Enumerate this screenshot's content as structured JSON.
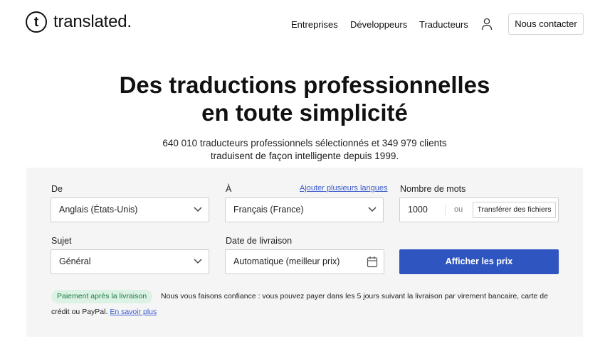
{
  "header": {
    "logo_glyph": "t",
    "logo_text": "translated.",
    "nav": [
      "Entreprises",
      "Développeurs",
      "Traducteurs"
    ],
    "user_icon": "user-icon",
    "contact_label": "Nous contacter"
  },
  "hero": {
    "title_line1": "Des traductions professionnelles",
    "title_line2": "en toute simplicité",
    "subtitle_line1": "640 010 traducteurs professionnels sélectionnés et 349 979 clients",
    "subtitle_line2": "traduisent de façon intelligente depuis 1999."
  },
  "form": {
    "from": {
      "label": "De",
      "value": "Anglais (États-Unis)"
    },
    "to": {
      "label": "À",
      "value": "Français (France)",
      "add_languages_link": "Ajouter plusieurs langues"
    },
    "words": {
      "label": "Nombre de mots",
      "value": "1000",
      "or_text": "ou",
      "upload_label": "Transférer des fichiers"
    },
    "subject": {
      "label": "Sujet",
      "value": "Général"
    },
    "delivery": {
      "label": "Date de livraison",
      "value": "Automatique (meilleur prix)"
    },
    "submit_label": "Afficher les prix",
    "payment_badge": "Paiement après la livraison",
    "payment_note": "Nous vous faisons confiance : vous pouvez payer dans les 5 jours suivant la livraison par virement bancaire, carte de crédit ou PayPal.",
    "learn_more": "En savoir plus"
  },
  "colors": {
    "accent": "#2f55c0",
    "link": "#3b5bcc",
    "badge_bg": "#dcf2e4",
    "badge_text": "#1f7a45",
    "panel_bg": "#f5f5f5"
  }
}
